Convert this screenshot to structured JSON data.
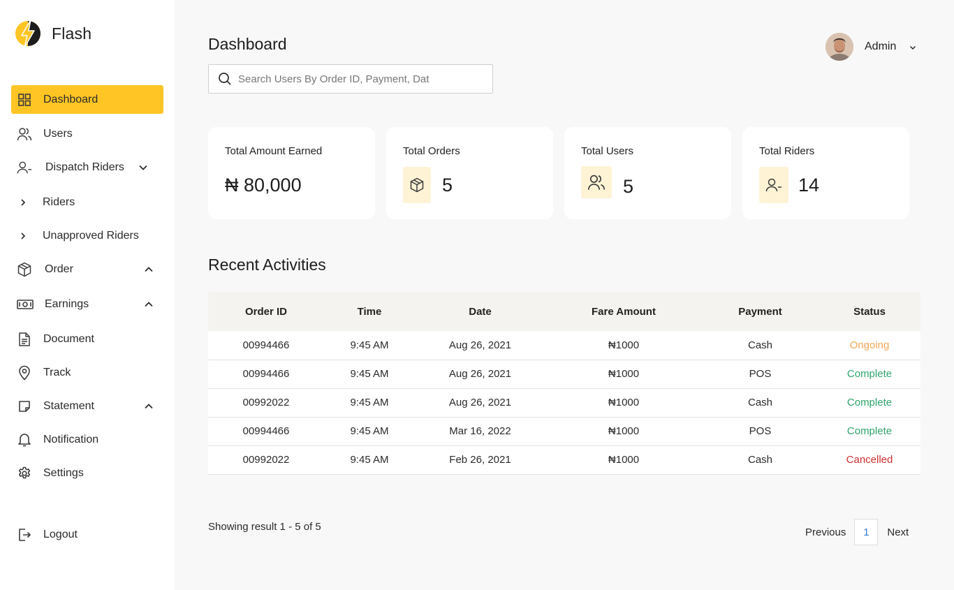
{
  "brand": {
    "name": "Flash",
    "accent": "#ffc525"
  },
  "sidebar": {
    "items": [
      {
        "label": "Dashboard",
        "icon": "grid-icon",
        "active": true
      },
      {
        "label": "Users",
        "icon": "users-icon"
      },
      {
        "label": "Dispatch Riders",
        "icon": "user-minus-icon",
        "chevron": "down"
      },
      {
        "label": "Riders",
        "icon": "chevron-right-icon",
        "sub": true
      },
      {
        "label": "Unapproved Riders",
        "icon": "chevron-right-icon",
        "sub": true
      },
      {
        "label": "Order",
        "icon": "box-icon",
        "chevron": "up"
      },
      {
        "label": "Earnings",
        "icon": "cash-icon",
        "chevron": "up"
      },
      {
        "label": "Document",
        "icon": "document-icon"
      },
      {
        "label": "Track",
        "icon": "location-pin-icon"
      },
      {
        "label": "Statement",
        "icon": "note-icon",
        "chevron": "up"
      },
      {
        "label": "Notification",
        "icon": "bell-icon"
      },
      {
        "label": "Settings",
        "icon": "gear-icon"
      }
    ],
    "logout": "Logout"
  },
  "header": {
    "title": "Dashboard",
    "search_placeholder": "Search Users By Order ID, Payment, Dat",
    "user_name": "Admin"
  },
  "cards": [
    {
      "title": "Total Amount Earned",
      "value": "₦ 80,000"
    },
    {
      "title": "Total Orders",
      "value": "5",
      "icon": "box-icon"
    },
    {
      "title": "Total Users",
      "value": "5",
      "icon": "users-icon"
    },
    {
      "title": "Total Riders",
      "value": "14",
      "icon": "user-minus-icon"
    }
  ],
  "activities": {
    "title": "Recent Activities",
    "columns": [
      "Order ID",
      "Time",
      "Date",
      "Fare Amount",
      "Payment",
      "Status"
    ],
    "rows": [
      {
        "id": "00994466",
        "time": "9:45 AM",
        "date": "Aug 26, 2021",
        "fare": "₦1000",
        "payment": "Cash",
        "status": "Ongoing",
        "status_color": "#f0a957"
      },
      {
        "id": "00994466",
        "time": "9:45 AM",
        "date": "Aug 26, 2021",
        "fare": "₦1000",
        "payment": "POS",
        "status": "Complete",
        "status_color": "#2fa56b"
      },
      {
        "id": "00992022",
        "time": "9:45 AM",
        "date": "Aug 26, 2021",
        "fare": "₦1000",
        "payment": "Cash",
        "status": "Complete",
        "status_color": "#2fa56b"
      },
      {
        "id": "00994466",
        "time": "9:45 AM",
        "date": "Mar 16, 2022",
        "fare": "₦1000",
        "payment": "POS",
        "status": "Complete",
        "status_color": "#2fa56b"
      },
      {
        "id": "00992022",
        "time": "9:45 AM",
        "date": "Feb 26, 2021",
        "fare": "₦1000",
        "payment": "Cash",
        "status": "Cancelled",
        "status_color": "#d02e2e"
      }
    ]
  },
  "pagination": {
    "summary": "Showing result 1 - 5 of 5",
    "previous": "Previous",
    "page": "1",
    "next": "Next"
  }
}
